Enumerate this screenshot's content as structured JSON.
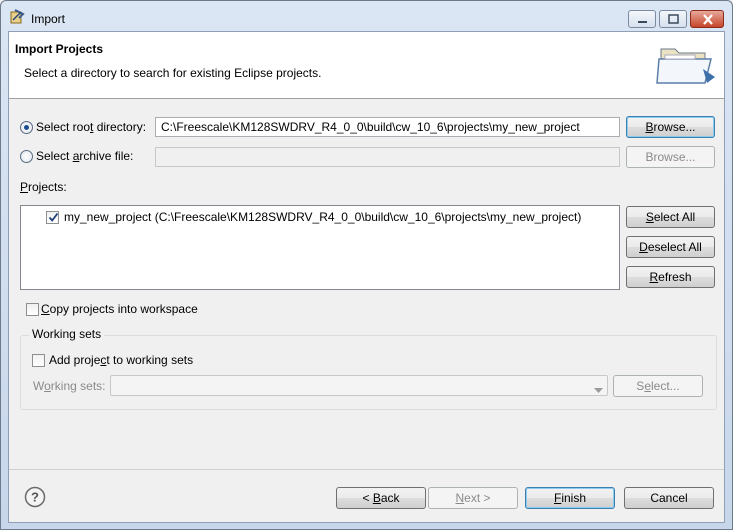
{
  "window": {
    "title": "Import",
    "icon": "eclipse-import-icon"
  },
  "banner": {
    "title": "Import Projects",
    "description": "Select a directory to search for existing Eclipse projects.",
    "icon": "folder-open-icon"
  },
  "root_directory": {
    "label_pre": "Select roo",
    "label_mn": "t",
    "label_post": " directory:",
    "selected": true,
    "value": "C:\\Freescale\\KM128SWDRV_R4_0_0\\build\\cw_10_6\\projects\\my_new_project",
    "browse_mn": "B",
    "browse_rest": "rowse..."
  },
  "archive_file": {
    "label_pre": "Select ",
    "label_mn": "a",
    "label_post": "rchive file:",
    "selected": false,
    "value": "",
    "browse_label": "Browse..."
  },
  "projects": {
    "label_mn": "P",
    "label_post": "rojects:",
    "items": [
      {
        "label": "my_new_project (C:\\Freescale\\KM128SWDRV_R4_0_0\\build\\cw_10_6\\projects\\my_new_project)",
        "checked": true
      }
    ],
    "select_all_mn": "S",
    "select_all_rest": "elect All",
    "deselect_all_mn": "D",
    "deselect_all_rest": "eselect All",
    "refresh_mn": "R",
    "refresh_rest": "efresh"
  },
  "copy_projects": {
    "label_mn": "C",
    "label_post": "opy projects into workspace",
    "checked": false
  },
  "working_sets": {
    "group_title": "Working sets",
    "add_label_pre": "Add proje",
    "add_label_mn": "c",
    "add_label_post": "t to working sets",
    "add_checked": false,
    "field_label_pre": "W",
    "field_label_mn": "o",
    "field_label_post": "rking sets:",
    "select_mn": "e",
    "select_pre": "S",
    "select_post": "lect..."
  },
  "footer": {
    "help_icon": "help-icon",
    "back_pre": "< ",
    "back_mn": "B",
    "back_post": "ack",
    "next_mn": "N",
    "next_post": "ext >",
    "finish_mn": "F",
    "finish_post": "inish",
    "cancel_label": "Cancel"
  }
}
